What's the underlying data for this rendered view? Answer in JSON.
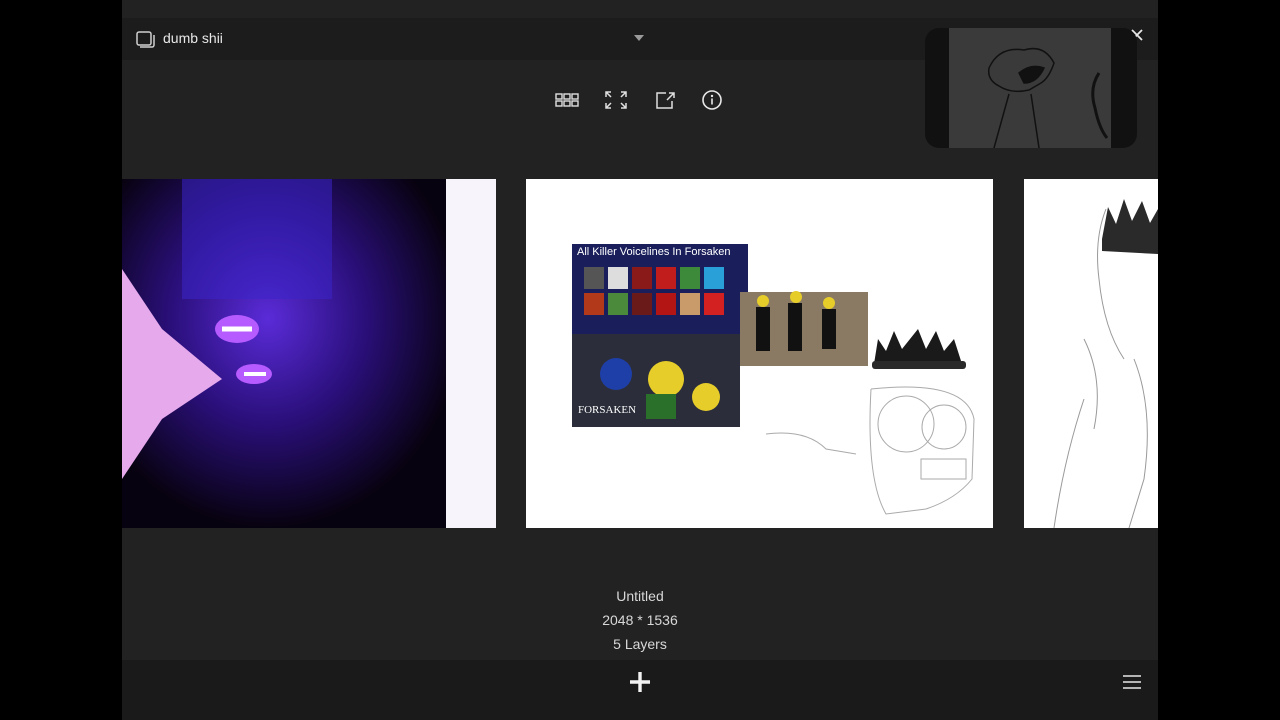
{
  "header": {
    "title": "dumb shii"
  },
  "artwork": {
    "name": "Untitled",
    "dimensions": "2048 * 1536",
    "layers": "5 Layers"
  },
  "thumbnail_center": {
    "banner_text": "All Killer Voicelines In Forsaken",
    "watermark": "FORSAKEN"
  },
  "icons": {
    "gallery": "gallery-icon",
    "dropdown": "chevron-down-icon",
    "close": "close-icon",
    "grid": "grid-view-icon",
    "fullscreen": "fullscreen-icon",
    "export": "export-icon",
    "info": "info-icon",
    "add": "plus-icon",
    "menu": "hamburger-menu-icon"
  },
  "colors": {
    "background": "#222222",
    "bar": "#1a1a1a",
    "text": "#e6e6e6"
  }
}
